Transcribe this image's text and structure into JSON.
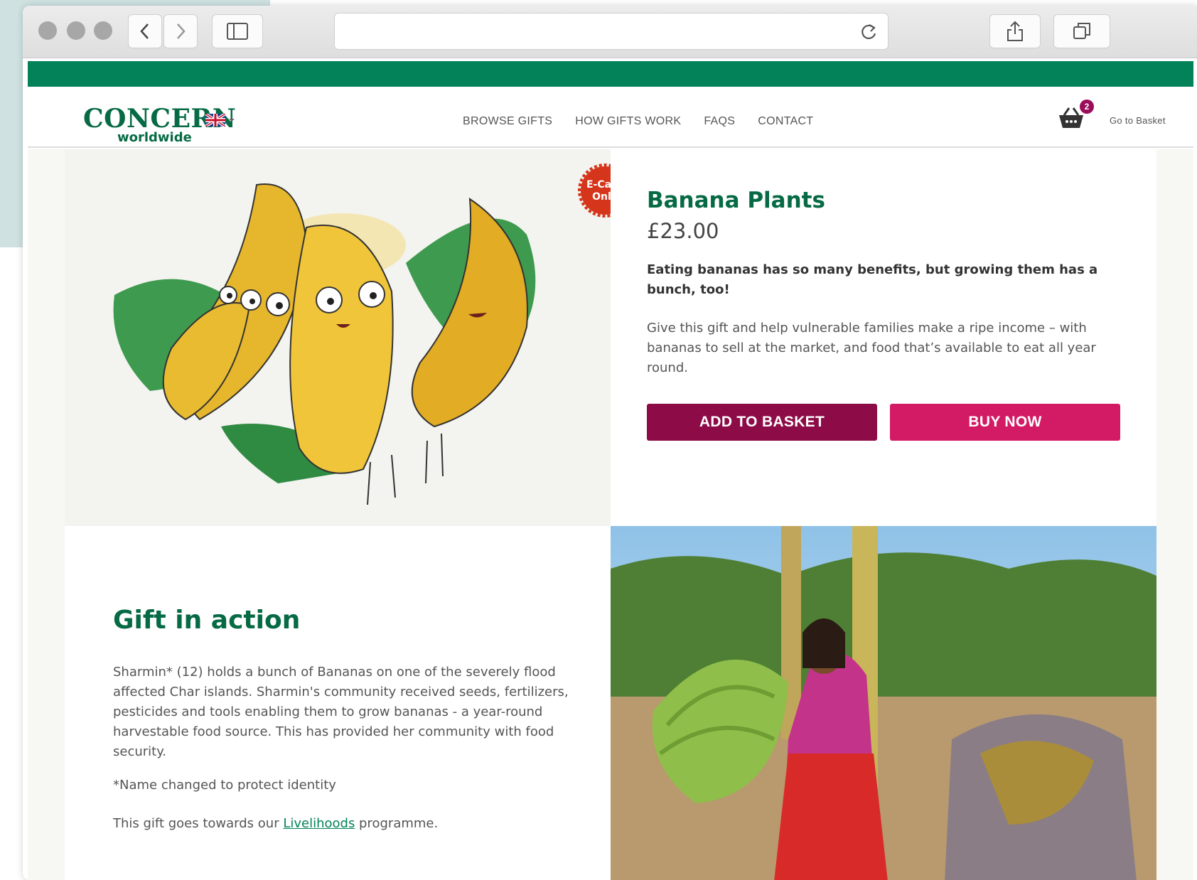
{
  "browser": {
    "icons": [
      "back-icon",
      "forward-icon",
      "sidebar-icon",
      "reload-icon",
      "share-icon",
      "tabs-icon"
    ]
  },
  "header": {
    "logo_line1": "CONCERN",
    "logo_line2": "worldwide",
    "nav": [
      "BROWSE GIFTS",
      "HOW GIFTS WORK",
      "FAQS",
      "CONTACT"
    ],
    "basket_count": "2",
    "basket_label": "Go to Basket"
  },
  "product": {
    "badge_line1": "E-Card",
    "badge_line2": "Only",
    "title": "Banana Plants",
    "price": "£23.00",
    "lead": "Eating bananas has so many benefits, but growing them has a bunch, too!",
    "description": "Give this gift and help vulnerable families make a ripe income – with bananas to sell at the market, and food that’s available to eat all year round.",
    "add_label": "ADD TO BASKET",
    "buy_label": "BUY NOW"
  },
  "gift_in_action": {
    "title": "Gift in action",
    "body": "Sharmin* (12) holds a bunch of Bananas on one of the severely flood affected Char islands. Sharmin's community received seeds, fertilizers, pesticides and tools enabling them to grow bananas - a year-round harvestable food source. This has provided her community with food security.",
    "note": "*Name changed to protect identity",
    "programme_prefix": "This gift goes towards our ",
    "programme_link": "Livelihoods",
    "programme_suffix": " programme."
  },
  "colors": {
    "brand_green": "#03825a",
    "title_green": "#066a44",
    "add_button": "#8d0b47",
    "buy_button": "#d31a65",
    "badge_red": "#d5351b"
  }
}
